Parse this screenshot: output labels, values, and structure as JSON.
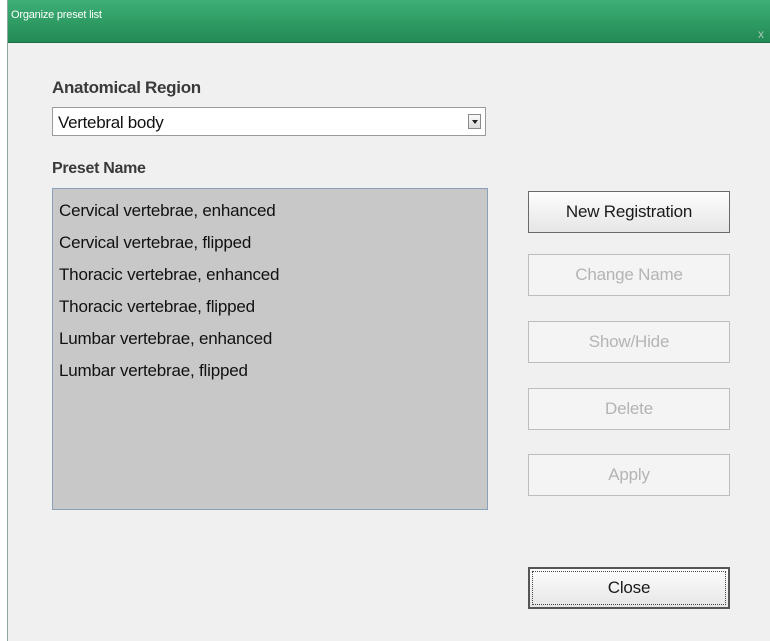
{
  "window": {
    "title": "Organize preset list",
    "close_glyph": "x"
  },
  "region": {
    "label": "Anatomical Region",
    "selected": "Vertebral body"
  },
  "presets": {
    "label": "Preset Name",
    "items": [
      "Cervical vertebrae, enhanced",
      "Cervical vertebrae, flipped",
      "Thoracic vertebrae, enhanced",
      "Thoracic vertebrae, flipped",
      "Lumbar vertebrae, enhanced",
      "Lumbar vertebrae, flipped"
    ]
  },
  "buttons": {
    "new_registration": "New Registration",
    "change_name": "Change Name",
    "show_hide": "Show/Hide",
    "delete": "Delete",
    "apply": "Apply",
    "close": "Close"
  },
  "colors": {
    "titlebar": "#2e9b63",
    "list_background": "#c8c8c8",
    "disabled_text": "#b4b4b4"
  }
}
